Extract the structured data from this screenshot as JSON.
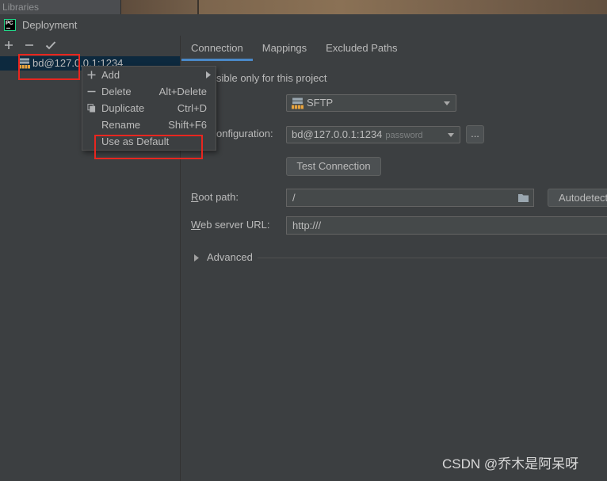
{
  "background_window": {
    "tab_label": "Libraries"
  },
  "window": {
    "title": "Deployment",
    "app_icon_label": "PC",
    "app_icon": "pycharm-logo-icon"
  },
  "server_toolbar": {
    "icons": [
      "plus-icon",
      "minus-icon",
      "check-icon"
    ]
  },
  "server_tree": {
    "items": [
      {
        "label": "bd@127.0.0.1:1234",
        "icon": "sftp-server-icon",
        "selected": true
      }
    ]
  },
  "context_menu": {
    "items": [
      {
        "label": "Add",
        "shortcut": "",
        "icon": "plus-icon",
        "has_submenu": true
      },
      {
        "label": "Delete",
        "shortcut": "Alt+Delete",
        "icon": "minus-icon"
      },
      {
        "label": "Duplicate",
        "shortcut": "Ctrl+D",
        "icon": "copy-icon"
      },
      {
        "label": "Rename",
        "shortcut": "Shift+F6"
      },
      {
        "label": "Use as Default",
        "shortcut": ""
      }
    ]
  },
  "tabs": [
    {
      "label": "Connection",
      "selected": true
    },
    {
      "label": "Mappings"
    },
    {
      "label": "Excluded Paths"
    }
  ],
  "connection": {
    "visible_only_label_fragment": "sible only for this project",
    "type": {
      "value": "SFTP",
      "icon": "sftp-server-icon"
    },
    "ssh_configuration": {
      "label_fragment": "onfiguration:",
      "value": "bd@127.0.0.1:1234",
      "auth_hint": "password",
      "browse_label": "..."
    },
    "test_connection_label": "Test Connection",
    "root_path": {
      "label": "Root path:",
      "value": "/",
      "autodetect_label": "Autodetect",
      "icon": "folder-icon"
    },
    "web_server_url": {
      "label": "Web server URL:",
      "value": "http:///"
    },
    "advanced": {
      "label": "Advanced",
      "expanded": false
    }
  },
  "watermark": "CSDN @乔木是阿呆呀",
  "colors": {
    "background": "#3c3f41",
    "selection": "#0d293e",
    "accent": "#4a88c7",
    "annotation": "#e8261f",
    "text": "#bbbbbb"
  }
}
